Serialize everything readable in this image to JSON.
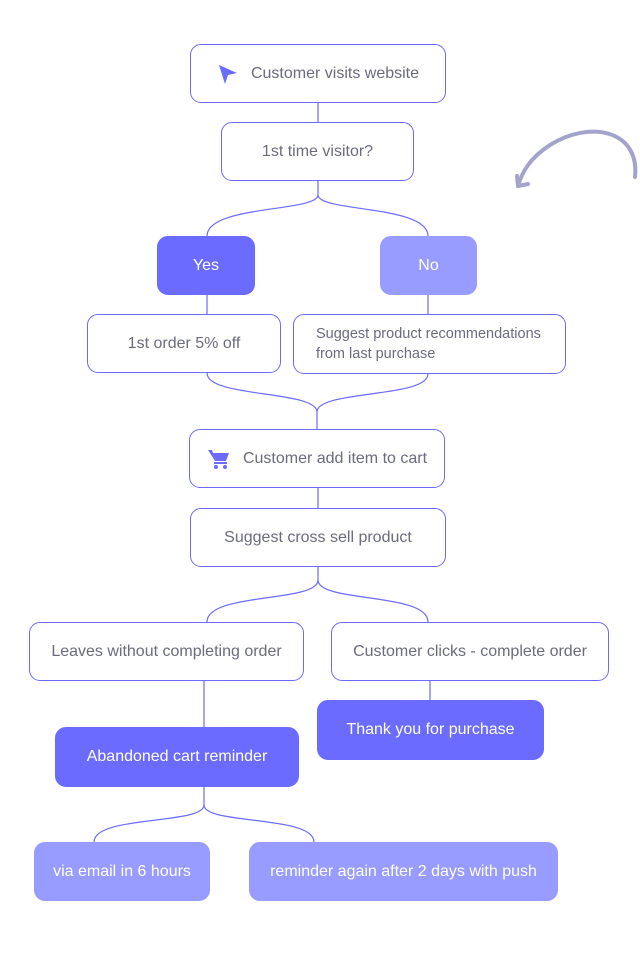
{
  "colors": {
    "border": "#6b6bff",
    "dark_fill": "#6b6bff",
    "light_fill": "#989bff",
    "text": "#6b6b7e",
    "arrow": "#a3a3cc"
  },
  "nodes": {
    "visits": {
      "label": "Customer visits website",
      "icon": "cursor-arrow-icon"
    },
    "first": {
      "label": "1st time visitor?"
    },
    "yes": {
      "label": "Yes"
    },
    "no": {
      "label": "No"
    },
    "order": {
      "label": "1st order 5% off"
    },
    "suggest": {
      "line1": "Suggest product recommendations",
      "line2": "from last purchase"
    },
    "cart": {
      "label": "Customer add item to cart",
      "icon": "shopping-cart-icon"
    },
    "cross": {
      "label": "Suggest cross sell product"
    },
    "leaves": {
      "label": "Leaves without completing order"
    },
    "clicks": {
      "label": "Customer clicks - complete order"
    },
    "thanks": {
      "label": "Thank you for purchase"
    },
    "aband": {
      "label": "Abandoned cart reminder"
    },
    "email": {
      "label": "via email in 6 hours"
    },
    "remind": {
      "label": "reminder again after 2 days with push"
    }
  }
}
